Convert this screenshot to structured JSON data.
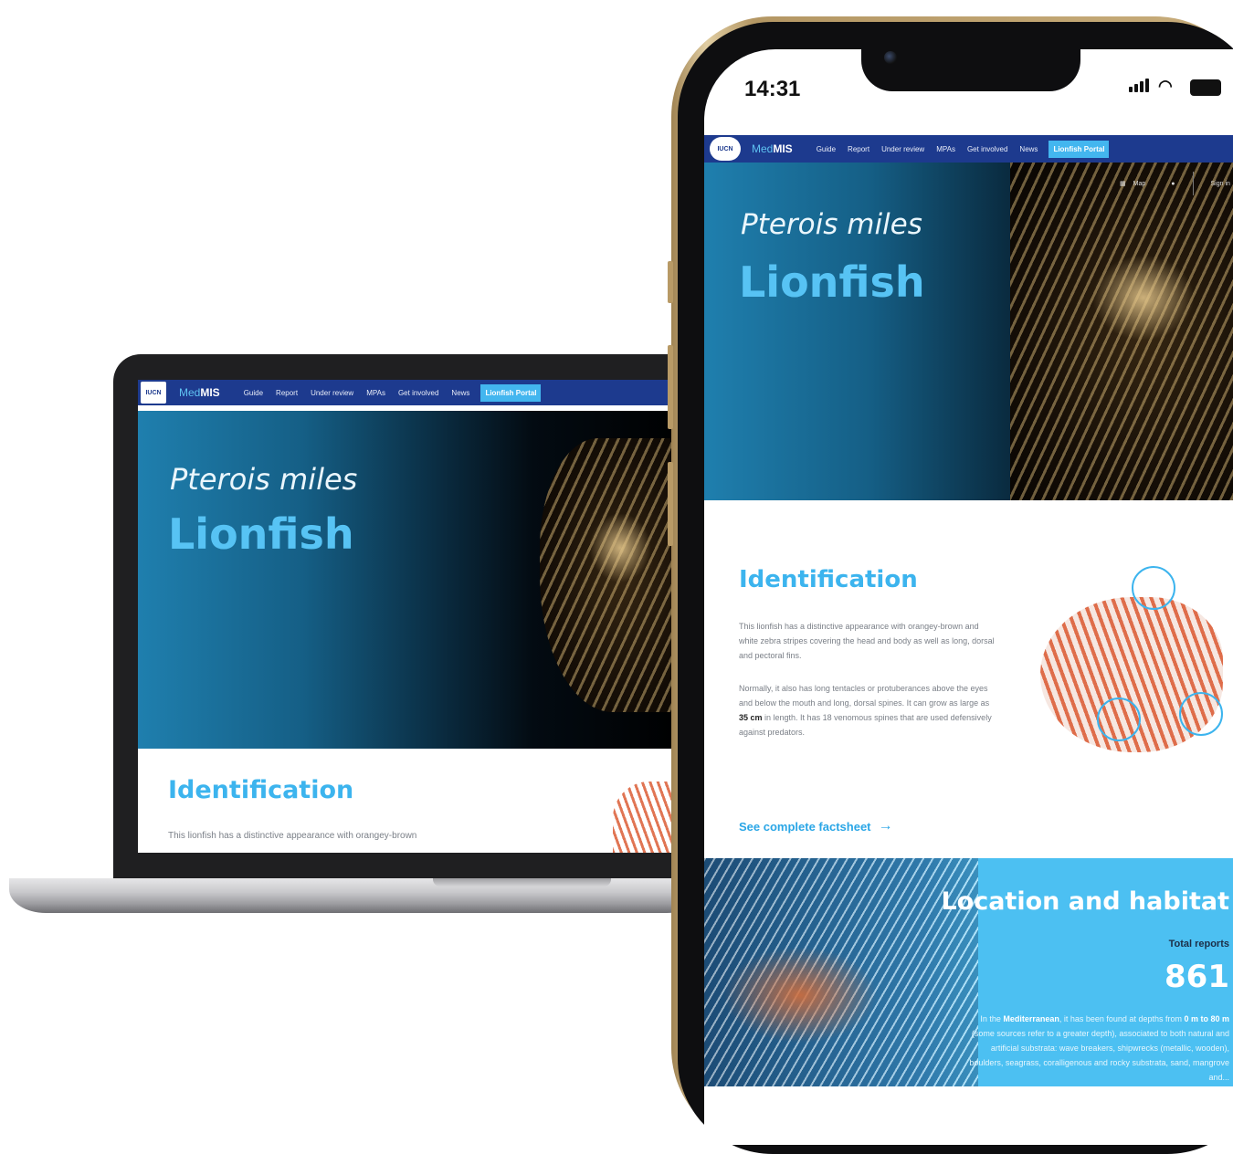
{
  "nav": {
    "logo": "IUCN",
    "brand_prefix": "Med",
    "brand_suffix": "MIS",
    "items": [
      "Guide",
      "Report",
      "Under review",
      "MPAs",
      "Get involved",
      "News",
      "Lionfish Portal"
    ],
    "active_index": 6,
    "map_label": "Map",
    "sign_in": "Sign in"
  },
  "hero": {
    "scientific_name": "Pterois miles",
    "common_name": "Lionfish"
  },
  "phone_status": {
    "time": "14:31"
  },
  "identification": {
    "title": "Identification",
    "laptop_text": "This lionfish has a distinctive appearance with orangey-brown",
    "para1": "This lionfish has a distinctive appearance with orangey-brown and white zebra stripes covering the head and body as well as long, dorsal and pectoral fins.",
    "para2_before": "Normally, it also has long tentacles or protuberances above the eyes and below the mouth and long, dorsal spines. It can grow as large as ",
    "para2_bold": "35 cm",
    "para2_after": " in length. It has 18 venomous spines that are used defensively against predators.",
    "link": "See complete factsheet"
  },
  "location": {
    "title": "Location and habitat",
    "total_label": "Total reports",
    "total_value": "861",
    "text_a": "In the ",
    "text_b": "Mediterranean",
    "text_c": ", it has been found at depths from ",
    "text_d": "0 m to 80 m",
    "text_e": " (some sources refer to a greater depth), associated to both natural and artificial substrata: wave breakers, shipwrecks (metallic, wooden), boulders, seagrass, coralligenous and rocky substrata, sand, mangrove and..."
  },
  "colors": {
    "nav_blue": "#1d3a8e",
    "accent_cyan": "#43b6ef",
    "title_cyan": "#3cb4ee",
    "location_bg": "#4cc0f2"
  }
}
